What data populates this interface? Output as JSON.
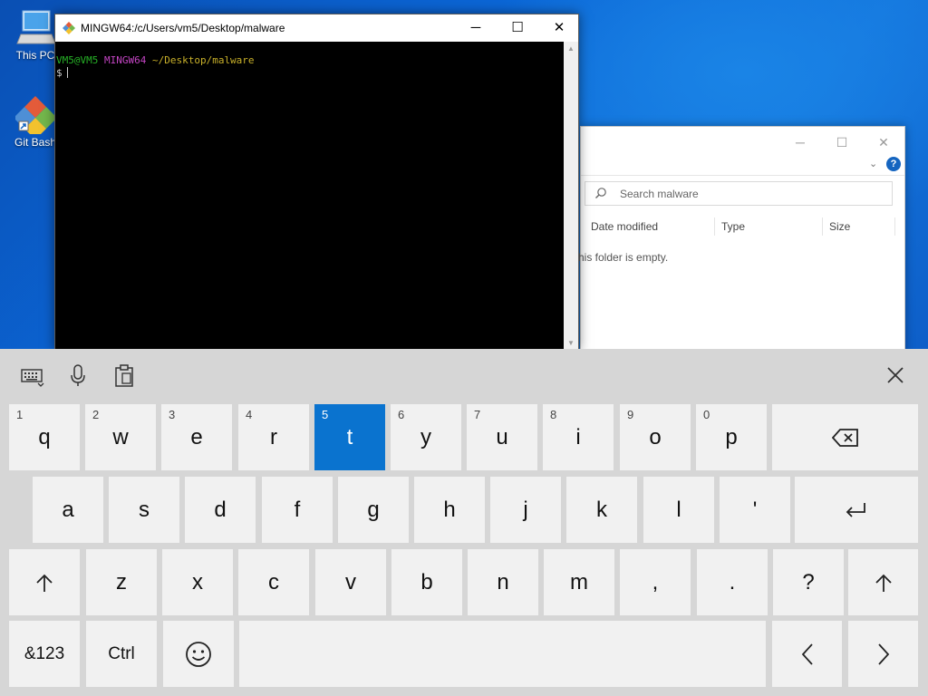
{
  "desktop": {
    "icons": [
      {
        "label": "This PC"
      },
      {
        "label": "Git Bash"
      }
    ]
  },
  "terminal": {
    "title": "MINGW64:/c/Users/vm5/Desktop/malware",
    "prompt_user": "VM5@VM5",
    "prompt_env": "MINGW64",
    "prompt_path": "~/Desktop/malware",
    "prompt_symbol": "$",
    "minimize": "─",
    "maximize": "☐",
    "close": "✕"
  },
  "explorer": {
    "search_placeholder": "Search malware",
    "columns": [
      "Date modified",
      "Type",
      "Size"
    ],
    "empty_text": "his folder is empty.",
    "help": "?",
    "minimize": "─",
    "maximize": "☐",
    "close": "✕"
  },
  "keyboard": {
    "row1": [
      {
        "num": "1",
        "ch": "q"
      },
      {
        "num": "2",
        "ch": "w"
      },
      {
        "num": "3",
        "ch": "e"
      },
      {
        "num": "4",
        "ch": "r"
      },
      {
        "num": "5",
        "ch": "t"
      },
      {
        "num": "6",
        "ch": "y"
      },
      {
        "num": "7",
        "ch": "u"
      },
      {
        "num": "8",
        "ch": "i"
      },
      {
        "num": "9",
        "ch": "o"
      },
      {
        "num": "0",
        "ch": "p"
      }
    ],
    "row2": [
      "a",
      "s",
      "d",
      "f",
      "g",
      "h",
      "j",
      "k",
      "l",
      "'"
    ],
    "row3": [
      "z",
      "x",
      "c",
      "v",
      "b",
      "n",
      "m",
      ",",
      ".",
      "?"
    ],
    "symbols_label": "&123",
    "ctrl_label": "Ctrl",
    "active_key": "t"
  },
  "colors": {
    "accent": "#0a73cf",
    "desktop": "#0b66d6",
    "keyboard_bg": "#d6d6d6",
    "key_bg": "#f1f1f1"
  }
}
